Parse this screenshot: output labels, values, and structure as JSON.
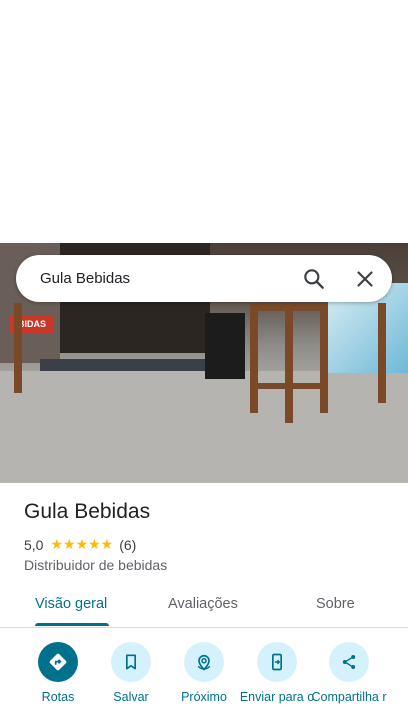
{
  "search": {
    "query": "Gula Bebidas"
  },
  "place": {
    "name": "Gula Bebidas",
    "rating": "5,0",
    "stars": "★★★★★",
    "rating_value": 5.0,
    "review_count": "(6)",
    "category": "Distribuidor de bebidas",
    "photo_sign_text": "BIDAS"
  },
  "tabs": [
    {
      "label": "Visão geral",
      "active": true
    },
    {
      "label": "Avaliações",
      "active": false
    },
    {
      "label": "Sobre",
      "active": false
    }
  ],
  "actions": [
    {
      "label": "Rotas",
      "icon": "directions-icon"
    },
    {
      "label": "Salvar",
      "icon": "bookmark-icon"
    },
    {
      "label": "Próximo",
      "icon": "nearby-icon"
    },
    {
      "label": "Enviar para o",
      "icon": "send-to-phone-icon"
    },
    {
      "label": "Compartilha r",
      "icon": "share-icon"
    }
  ],
  "colors": {
    "accent": "#00718d",
    "action_bg": "#d5f1fb",
    "star": "#fbbc04"
  }
}
